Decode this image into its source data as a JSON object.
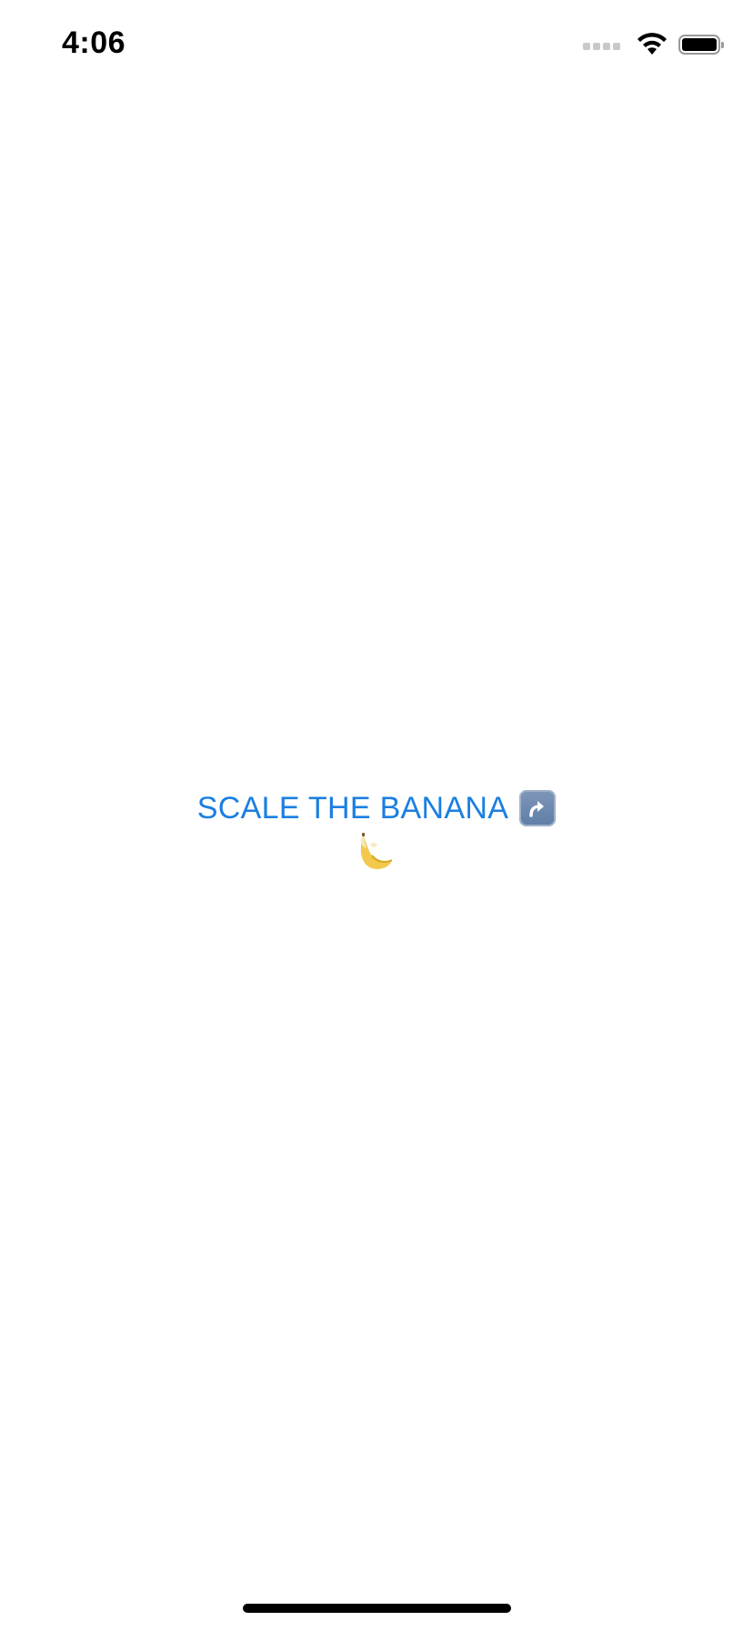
{
  "status_bar": {
    "time": "4:06",
    "icons": [
      "cellular-signal-icon",
      "wifi-icon",
      "battery-icon"
    ]
  },
  "main": {
    "headline": "SCALE THE BANANA",
    "arrow_icon": "arrow-up-right-curved-icon",
    "banana_icon": "banana-emoji-icon"
  },
  "colors": {
    "accent": "#1b7fe0",
    "background": "#ffffff",
    "banana_yellow": "#f2c94c"
  }
}
